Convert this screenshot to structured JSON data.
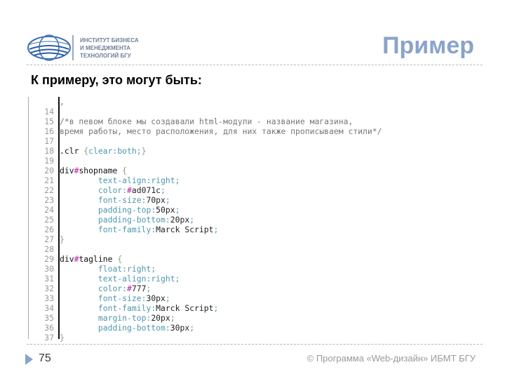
{
  "logo": {
    "lines": [
      "ИНСТИТУТ БИЗНЕСА",
      "И МЕНЕДЖМЕНТА",
      "ТЕХНОЛОГИЙ БГУ"
    ]
  },
  "title": "Пример",
  "heading": "К примеру, это могут быть:",
  "code": [
    {
      "n": "",
      "t": [
        [
          "com",
          ","
        ]
      ]
    },
    {
      "n": "14",
      "t": []
    },
    {
      "n": "15",
      "t": [
        [
          "com",
          "/*в певом блоке мы создавали html-модули - название магазина,"
        ]
      ]
    },
    {
      "n": "16",
      "t": [
        [
          "com",
          "время работы, место расположения, для них также прописываем стили*/"
        ]
      ]
    },
    {
      "n": "17",
      "t": []
    },
    {
      "n": "18",
      "t": [
        [
          "sel",
          ".clr "
        ],
        [
          "brace",
          "{"
        ],
        [
          "prop",
          "clear"
        ],
        [
          "punc",
          ":"
        ],
        [
          "prop",
          "both"
        ],
        [
          "punc",
          ";"
        ],
        [
          "brace",
          "}"
        ]
      ]
    },
    {
      "n": "19",
      "t": []
    },
    {
      "n": "20",
      "t": [
        [
          "sel",
          "div"
        ],
        [
          "hash",
          "#"
        ],
        [
          "sel",
          "shopname "
        ],
        [
          "brace",
          "{"
        ]
      ]
    },
    {
      "n": "21",
      "t": [
        [
          "sel",
          "        "
        ],
        [
          "prop",
          "text-align"
        ],
        [
          "punc",
          ":"
        ],
        [
          "prop",
          "right"
        ],
        [
          "punc",
          ";"
        ]
      ]
    },
    {
      "n": "22",
      "t": [
        [
          "sel",
          "        "
        ],
        [
          "prop",
          "color"
        ],
        [
          "punc",
          ":"
        ],
        [
          "hash",
          "#"
        ],
        [
          "val",
          "ad071c"
        ],
        [
          "punc",
          ";"
        ]
      ]
    },
    {
      "n": "23",
      "t": [
        [
          "sel",
          "        "
        ],
        [
          "prop",
          "font-size"
        ],
        [
          "punc",
          ":"
        ],
        [
          "val",
          "70px"
        ],
        [
          "punc",
          ";"
        ]
      ]
    },
    {
      "n": "24",
      "t": [
        [
          "sel",
          "        "
        ],
        [
          "prop",
          "padding-top"
        ],
        [
          "punc",
          ":"
        ],
        [
          "val",
          "50px"
        ],
        [
          "punc",
          ";"
        ]
      ]
    },
    {
      "n": "25",
      "t": [
        [
          "sel",
          "        "
        ],
        [
          "prop",
          "padding-bottom"
        ],
        [
          "punc",
          ":"
        ],
        [
          "val",
          "20px"
        ],
        [
          "punc",
          ";"
        ]
      ]
    },
    {
      "n": "26",
      "t": [
        [
          "sel",
          "        "
        ],
        [
          "prop",
          "font-family"
        ],
        [
          "punc",
          ":"
        ],
        [
          "val",
          "Marck Script"
        ],
        [
          "punc",
          ";"
        ]
      ]
    },
    {
      "n": "27",
      "t": [
        [
          "brace",
          "}"
        ]
      ]
    },
    {
      "n": "28",
      "t": []
    },
    {
      "n": "29",
      "t": [
        [
          "sel",
          "div"
        ],
        [
          "hash",
          "#"
        ],
        [
          "sel",
          "tagline "
        ],
        [
          "brace",
          "{"
        ]
      ]
    },
    {
      "n": "30",
      "t": [
        [
          "sel",
          "        "
        ],
        [
          "prop",
          "float"
        ],
        [
          "punc",
          ":"
        ],
        [
          "prop",
          "right"
        ],
        [
          "punc",
          ";"
        ]
      ]
    },
    {
      "n": "31",
      "t": [
        [
          "sel",
          "        "
        ],
        [
          "prop",
          "text-align"
        ],
        [
          "punc",
          ":"
        ],
        [
          "prop",
          "right"
        ],
        [
          "punc",
          ";"
        ]
      ]
    },
    {
      "n": "32",
      "t": [
        [
          "sel",
          "        "
        ],
        [
          "prop",
          "color"
        ],
        [
          "punc",
          ":"
        ],
        [
          "hash",
          "#"
        ],
        [
          "val",
          "777"
        ],
        [
          "punc",
          ";"
        ]
      ]
    },
    {
      "n": "33",
      "t": [
        [
          "sel",
          "        "
        ],
        [
          "prop",
          "font-size"
        ],
        [
          "punc",
          ":"
        ],
        [
          "val",
          "30px"
        ],
        [
          "punc",
          ";"
        ]
      ]
    },
    {
      "n": "34",
      "t": [
        [
          "sel",
          "        "
        ],
        [
          "prop",
          "font-family"
        ],
        [
          "punc",
          ":"
        ],
        [
          "val",
          "Marck Script"
        ],
        [
          "punc",
          ";"
        ]
      ]
    },
    {
      "n": "35",
      "t": [
        [
          "sel",
          "        "
        ],
        [
          "prop",
          "margin-top"
        ],
        [
          "punc",
          ":"
        ],
        [
          "val",
          "20px"
        ],
        [
          "punc",
          ";"
        ]
      ]
    },
    {
      "n": "36",
      "t": [
        [
          "sel",
          "        "
        ],
        [
          "prop",
          "padding-bottom"
        ],
        [
          "punc",
          ":"
        ],
        [
          "val",
          "30px"
        ],
        [
          "punc",
          ";"
        ]
      ]
    },
    {
      "n": "37",
      "t": [
        [
          "brace",
          "}"
        ]
      ]
    }
  ],
  "footer": {
    "page": "75",
    "text": "© Программа «Web-дизайн» ИБМТ БГУ"
  },
  "colors": {
    "accent": "#8aa3cc"
  }
}
